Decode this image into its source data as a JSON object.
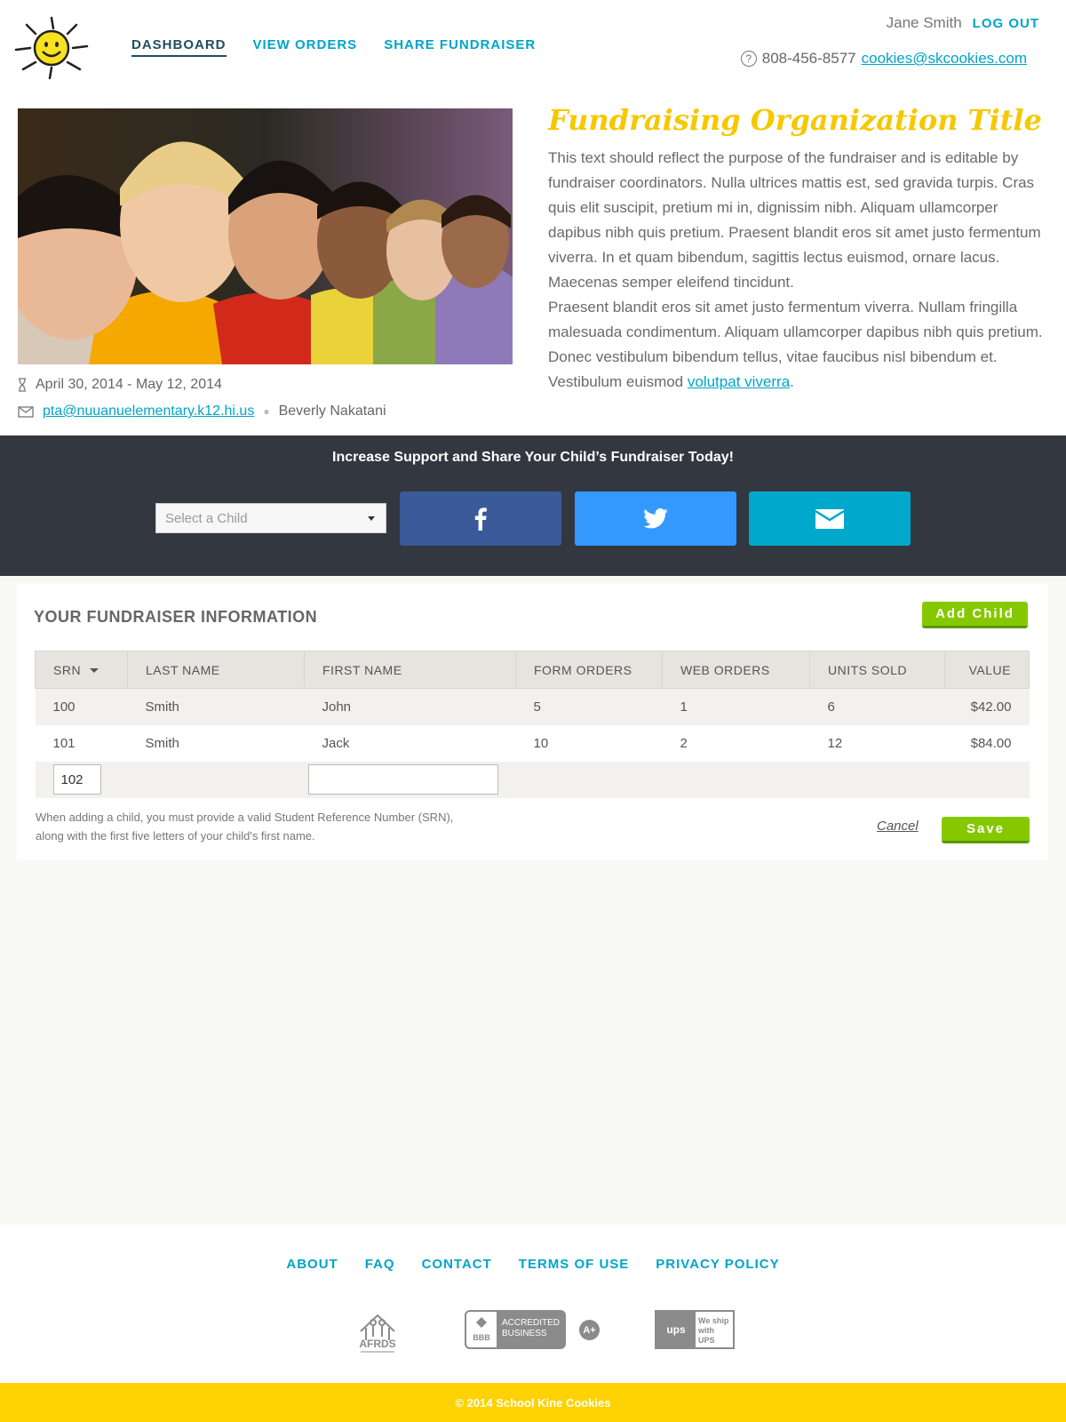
{
  "header": {
    "logo_alt": "School Kine Cookies sun logo",
    "nav": [
      {
        "label": "DASHBOARD",
        "active": true
      },
      {
        "label": "VIEW ORDERS",
        "active": false
      },
      {
        "label": "SHARE FUNDRAISER",
        "active": false
      }
    ],
    "user_name": "Jane Smith",
    "logout_label": "LOG OUT",
    "phone": "808-456-8577",
    "email": "cookies@skcookies.com",
    "help_icon": "question-circle-icon"
  },
  "hero": {
    "photo_description": "Group of smiling children in colorful shirts",
    "date_range": "April 30, 2014 - May 12, 2014",
    "contact_email": "pta@nuuanuelementary.k12.hi.us",
    "contact_name": "Beverly Nakatani",
    "title": "Fundraising Organization Title",
    "paragraph_1": "This text should reflect the purpose of the fundraiser and is editable by fundraiser coordinators. Nulla ultrices mattis est, sed gravida turpis. Cras quis elit suscipit, pretium mi in, dignissim nibh. Aliquam ullamcorper dapibus nibh quis pretium. Praesent blandit eros sit amet justo fermentum viverra. In et quam bibendum, sagittis lectus euismod, ornare lacus.",
    "paragraph_2": "Maecenas semper eleifend tincidunt.",
    "paragraph_3": "Praesent blandit eros sit amet justo fermentum viverra.  Nullam fringilla malesuada condimentum. Aliquam ullamcorper dapibus nibh quis pretium. Donec vestibulum bibendum tellus, vitae faucibus nisl bibendum et. Vestibulum euismod",
    "paragraph_3_link": "volutpat viverra",
    "paragraph_3_end": "."
  },
  "share": {
    "title": "Increase Support and Share Your Child’s Fundraiser Today!",
    "select_placeholder": "Select a Child",
    "buttons": [
      "facebook-icon",
      "twitter-icon",
      "email-icon"
    ],
    "colors": {
      "facebook": "#3b5a9a",
      "twitter": "#3399ff",
      "email": "#00a8cc"
    }
  },
  "fundraiser": {
    "title": "YOUR FUNDRAISER INFORMATION",
    "add_child_label": "Add Child",
    "columns": [
      "SRN",
      "LAST NAME",
      "FIRST NAME",
      "FORM ORDERS",
      "WEB ORDERS",
      "UNITS SOLD",
      "VALUE"
    ],
    "rows": [
      [
        "100",
        "Smith",
        "John",
        "5",
        "1",
        "6",
        "$42.00"
      ],
      [
        "101",
        "Smith",
        "Jack",
        "10",
        "2",
        "12",
        "$84.00"
      ]
    ],
    "new_row": {
      "srn_value": "102",
      "first_name_value": ""
    },
    "note": "When adding a child, you must provide a valid Student Reference Number (SRN), along with the first five letters of your child's first name.",
    "cancel_label": "Cancel",
    "save_label": "Save"
  },
  "footer": {
    "links": [
      "ABOUT",
      "FAQ",
      "CONTACT",
      "TERMS OF USE",
      "PRIVACY POLICY"
    ],
    "badges": {
      "afrds": "AFRDS",
      "bbb_logo": "BBB",
      "bbb_text_1": "ACCREDITED",
      "bbb_text_2": "BUSINESS",
      "bbb_rating": "A+",
      "ups_logo": "ups",
      "ups_text_1": "We ship",
      "ups_text_2": "with UPS"
    },
    "copyright": "© 2014 School Kine Cookies"
  },
  "colors": {
    "accent": "#00a4c8",
    "title_yellow": "#f5c800",
    "green": "#86c800",
    "dark_band": "#323740",
    "footer_yellow": "#fdd200"
  }
}
